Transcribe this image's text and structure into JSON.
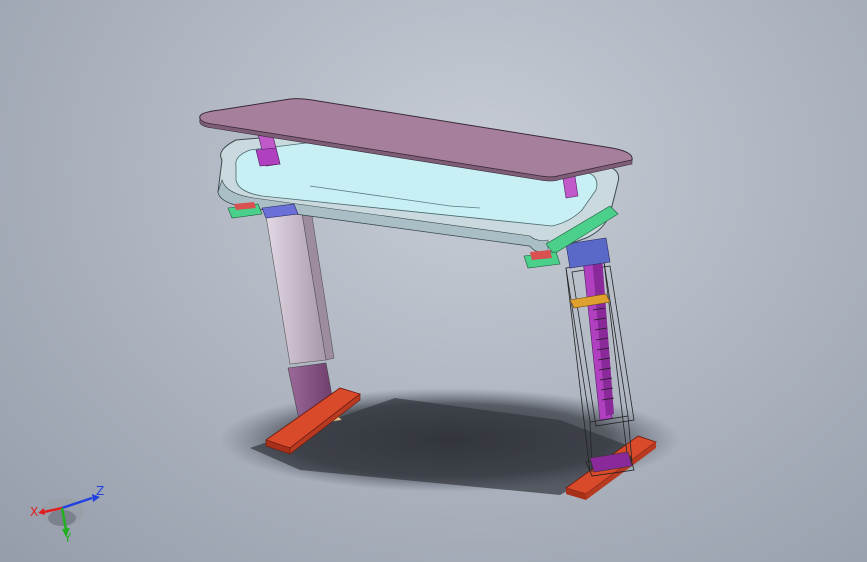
{
  "triad": {
    "x_label": "X",
    "y_label": "Y",
    "z_label": "Z",
    "x_color": "#e02020",
    "y_color": "#20b020",
    "z_color": "#2040e0"
  },
  "colors": {
    "tabletop": "#a67f9d",
    "frame": "#bfe0e4",
    "frame_inner": "#c8f0f4",
    "column_outer": "#c6b8c8",
    "column_inner": "#8e5a8c",
    "foot": "#d84a2a",
    "actuator": "#b040c0",
    "bracket": "#4ad08a"
  }
}
